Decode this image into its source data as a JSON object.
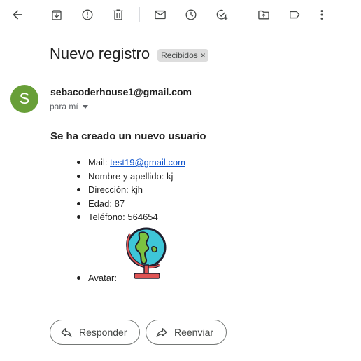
{
  "toolbar": {
    "icons": [
      "back-icon",
      "archive-icon",
      "report-spam-icon",
      "delete-icon",
      "mark-unread-icon",
      "snooze-icon",
      "add-task-icon",
      "move-to-icon",
      "label-icon",
      "more-options-icon"
    ]
  },
  "email": {
    "subject": "Nuevo registro",
    "label": "Recibidos",
    "label_remove": "×",
    "sender_initial": "S",
    "sender_email": "sebacoderhouse1@gmail.com",
    "recipient": "para mí",
    "body_title": "Se ha creado un nuevo usuario",
    "fields": {
      "mail_label": "Mail: ",
      "mail_value": "test19@gmail.com",
      "name": "Nombre y apellido: kj",
      "address": "Dirección: kjh",
      "age": "Edad: 87",
      "phone": "Teléfono: 564654",
      "avatar": "Avatar:"
    }
  },
  "actions": {
    "reply": "Responder",
    "forward": "Reenviar"
  },
  "colors": {
    "avatar_bg": "#689f38",
    "link": "#1155cc",
    "chip_bg": "#dddddd"
  }
}
